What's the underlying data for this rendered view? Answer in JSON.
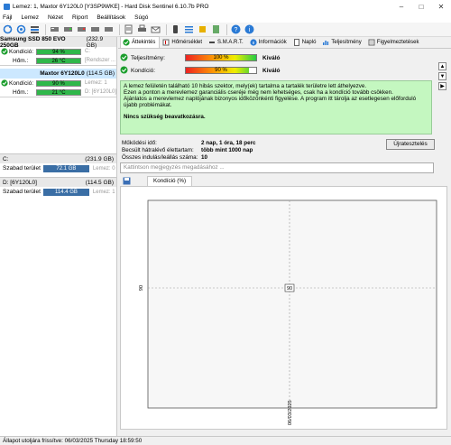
{
  "window": {
    "title": "Lemez: 1, Maxtor 6Y120L0 [Y3SP9WKE] - Hard Disk Sentinel 6.10.7b PRO"
  },
  "menu": [
    "Fájl",
    "Lemez",
    "Nézet",
    "Riport",
    "Beállítások",
    "Súgó"
  ],
  "disks": [
    {
      "header": "Samsung SSD 850 EVO 250GB",
      "size": "(232.9 GB)",
      "drive": "Disk: 0",
      "condition_label": "Kondíció:",
      "condition": "94 %",
      "condition_value": 94,
      "temp_label": "Hőm.:",
      "temp": "26 °C",
      "extra": "C:",
      "extra2": "[Rendszer ..."
    },
    {
      "header": "Maxtor 6Y120L0",
      "size": "(114.5 GB)",
      "drive": "Disk: 1",
      "condition_label": "Kondíció:",
      "condition": "90 %",
      "condition_value": 90,
      "temp_label": "Hőm.:",
      "temp": "21 °C",
      "extra": "Lemez: 1",
      "extra2": "D: [6Y120L0]"
    }
  ],
  "volumes": [
    {
      "name": "C:",
      "size": "(231.9 GB)",
      "free_label": "Szabad terület",
      "free": "72.1 GB",
      "disk": "Lemez: 0"
    },
    {
      "name": "D: [6Y120L0]",
      "size": "(114.5 GB)",
      "free_label": "Szabad terület",
      "free": "114.4 GB",
      "disk": "Lemez: 1"
    }
  ],
  "tabs": [
    "Áttekintés",
    "Hőmérséklet",
    "S.M.A.R.T.",
    "Információk",
    "Napló",
    "Teljesítmény",
    "Figyelmeztetések"
  ],
  "status": {
    "performance_label": "Teljesítmény:",
    "performance": "100 %",
    "performance_value": 100,
    "performance_rating": "Kiváló",
    "health_label": "Kondíció:",
    "health": "90 %",
    "health_value": 90,
    "health_rating": "Kiváló"
  },
  "info": {
    "line1": "A lemez felületén található 10 hibás szektor, mely(ek) tartalma a tartalék területre lett áthelyezve.",
    "line2": "Ezen a ponton a merevlemez garanciális cseréje még nem lehetséges, csak ha a kondíció tovább csökken.",
    "line3": "Ajánlatos a merevlemez naplójának bizonyos időközönkénti figyelése. A program itt tárolja az esetlegesen előforduló újabb problémákat.",
    "line4": "Nincs szükség beavatkozásra."
  },
  "facts": [
    {
      "k": "Működési idő:",
      "v": "2 nap, 1 óra, 18 perc"
    },
    {
      "k": "Becsült hátralévő élettartam:",
      "v": "több mint 1000 nap"
    },
    {
      "k": "Összes indulás/leállás száma:",
      "v": "10"
    }
  ],
  "notify_button": "Újratesztelés",
  "comment_placeholder": "Kattintson megjegyzés megadásához ...",
  "chart_tab": "Kondíció  (%)",
  "chart_data": {
    "type": "line",
    "title": "",
    "x": [
      "06/03/2025"
    ],
    "series": [
      {
        "name": "Kondíció",
        "values": [
          90
        ]
      }
    ],
    "point_label": "90",
    "ylabel": "90",
    "xlabel": "06/03/2025"
  },
  "statusbar": "Állapot utoljára frissítve: 06/03/2025 Thursday 18:59:50"
}
